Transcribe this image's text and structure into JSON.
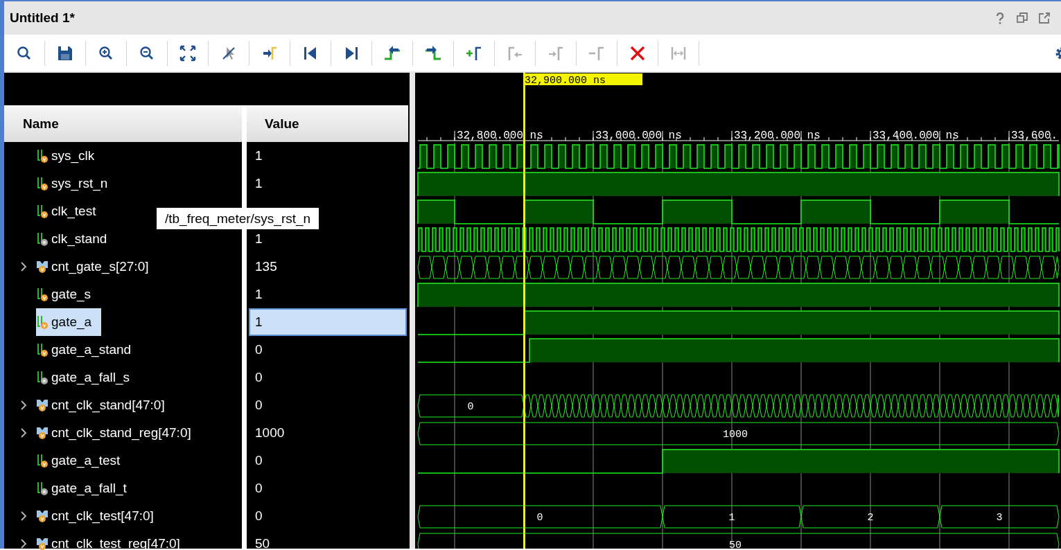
{
  "window": {
    "title": "Untitled 1*"
  },
  "title_buttons": [
    {
      "kind": "help"
    },
    {
      "kind": "restore"
    },
    {
      "kind": "popout"
    }
  ],
  "toolbar": [
    {
      "kind": "search",
      "disabled": false
    },
    {
      "kind": "save",
      "disabled": false
    },
    {
      "kind": "zoom_in",
      "disabled": false
    },
    {
      "kind": "zoom_out",
      "disabled": false
    },
    {
      "kind": "zoom_fit",
      "disabled": false
    },
    {
      "kind": "cursor_off",
      "disabled": false
    },
    {
      "kind": "to_marker",
      "disabled": false
    },
    {
      "kind": "go_start",
      "disabled": false
    },
    {
      "kind": "go_end",
      "disabled": false
    },
    {
      "kind": "prev_edge",
      "disabled": false
    },
    {
      "kind": "next_edge",
      "disabled": false
    },
    {
      "kind": "add_marker",
      "disabled": false
    },
    {
      "kind": "prev_marker",
      "disabled": true
    },
    {
      "kind": "next_marker",
      "disabled": true
    },
    {
      "kind": "remove_marker",
      "disabled": true
    },
    {
      "kind": "delete",
      "disabled": false
    },
    {
      "kind": "swap",
      "disabled": true
    },
    {
      "kind": "settings",
      "disabled": false
    }
  ],
  "columns": [
    "Name",
    "Value"
  ],
  "cursor": {
    "label": "32,900.000 ns"
  },
  "time_axis": [
    "32,800.000 ns",
    "33,000.000 ns",
    "33,200.000 ns",
    "33,400.000 ns",
    "33,600."
  ],
  "signals": [
    {
      "name": "sys_clk",
      "value": "1",
      "kind": "wire",
      "selected": false,
      "wave": {
        "kind": "clock"
      }
    },
    {
      "name": "sys_rst_n",
      "value": "1",
      "kind": "wire",
      "selected": false,
      "wave": {
        "kind": "high"
      }
    },
    {
      "name": "clk_test",
      "kind": "wire",
      "selected": false,
      "wave": {
        "kind": "clock_slow"
      }
    },
    {
      "name": "clk_stand",
      "value": "1",
      "kind": "wire_internal",
      "selected": false,
      "wave": {
        "kind": "clock_fast"
      }
    },
    {
      "name": "cnt_gate_s[27:0]",
      "value": "135",
      "kind": "bus",
      "expanded": false,
      "selected": false,
      "wave": {
        "kind": "bus_fast"
      }
    },
    {
      "name": "gate_s",
      "value": "1",
      "kind": "wire",
      "selected": false,
      "wave": {
        "kind": "high"
      }
    },
    {
      "name": "gate_a",
      "value": "1",
      "kind": "wire",
      "selected": true,
      "wave": {
        "kind": "rise"
      }
    },
    {
      "name": "gate_a_stand",
      "value": "0",
      "kind": "wire",
      "selected": false,
      "wave": {
        "kind": "rise_late"
      }
    },
    {
      "name": "gate_a_fall_s",
      "value": "0",
      "kind": "wire_internal",
      "selected": false,
      "wave": {
        "kind": "none"
      }
    },
    {
      "name": "cnt_clk_stand[47:0]",
      "value": "0",
      "kind": "bus",
      "expanded": false,
      "selected": false,
      "wave": {
        "kind": "bus_count",
        "values": [
          "0"
        ]
      }
    },
    {
      "name": "cnt_clk_stand_reg[47:0]",
      "value": "1000",
      "kind": "bus",
      "expanded": false,
      "selected": false,
      "wave": {
        "kind": "bus_const",
        "values": [
          "1000"
        ]
      }
    },
    {
      "name": "gate_a_test",
      "value": "0",
      "kind": "wire",
      "selected": false,
      "wave": {
        "kind": "rise_later"
      }
    },
    {
      "name": "gate_a_fall_t",
      "value": "0",
      "kind": "wire_internal",
      "selected": false,
      "wave": {
        "kind": "none"
      }
    },
    {
      "name": "cnt_clk_test[47:0]",
      "value": "0",
      "kind": "bus",
      "expanded": false,
      "selected": false,
      "wave": {
        "kind": "bus_steps",
        "values": [
          "0",
          "1",
          "2",
          "3"
        ]
      }
    },
    {
      "name": "cnt_clk_test_reg[47:0]",
      "value": "50",
      "kind": "bus",
      "expanded": false,
      "selected": false,
      "wave": {
        "kind": "bus_const",
        "values": [
          "50"
        ]
      }
    }
  ],
  "tooltip": "/tb_freq_meter/sys_rst_n"
}
